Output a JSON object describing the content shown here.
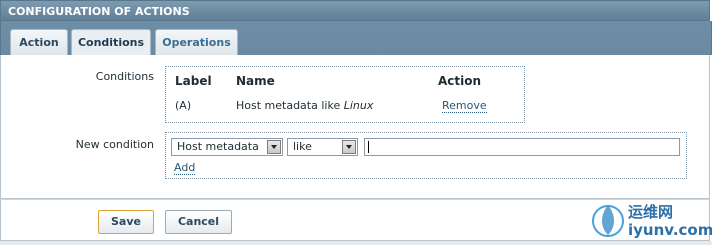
{
  "header": {
    "title": "CONFIGURATION OF ACTIONS"
  },
  "tabs": [
    {
      "label": "Action"
    },
    {
      "label": "Conditions"
    },
    {
      "label": "Operations"
    }
  ],
  "conditions": {
    "label": "Conditions",
    "columns": [
      "Label",
      "Name",
      "Action"
    ],
    "rows": [
      {
        "label": "(A)",
        "name_prefix": "Host metadata like",
        "name_value": "Linux",
        "action": "Remove"
      }
    ]
  },
  "new_condition": {
    "label": "New condition",
    "type_select": "Host metadata",
    "operator_select": "like",
    "value": "",
    "add_link": "Add"
  },
  "footer": {
    "save_label": "Save",
    "cancel_label": "Cancel"
  },
  "watermark": {
    "line1": "运维网",
    "line2": "iyunv.com"
  }
}
